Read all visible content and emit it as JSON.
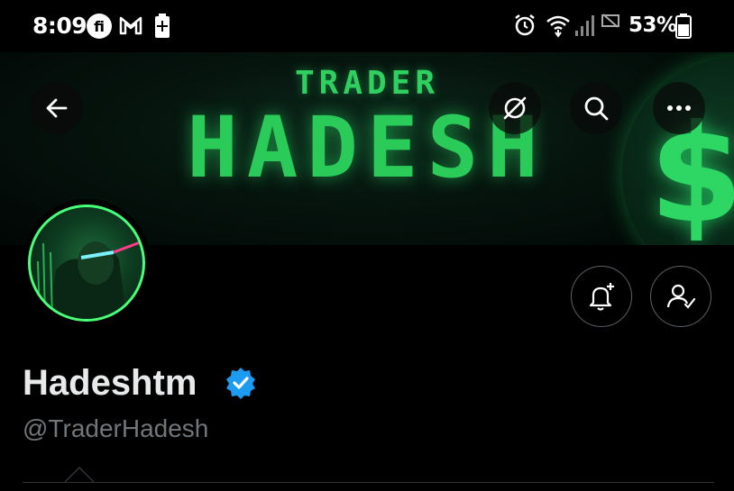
{
  "status_bar": {
    "time": "8:09",
    "battery_percent": "53%",
    "left_icons": [
      "fi-app-icon",
      "gmail-icon",
      "battery-saver-icon"
    ],
    "right_icons": [
      "alarm-icon",
      "wifi-icon",
      "signal-icon",
      "no-sim-icon",
      "battery-icon"
    ]
  },
  "banner": {
    "line1": "TRADER",
    "line2": "HADESH",
    "accent_color": "#2acb58"
  },
  "header_actions": {
    "back": "back-arrow-icon",
    "grok": "grok-icon",
    "search": "search-icon",
    "more": "more-icon"
  },
  "profile": {
    "display_name": "Hadeshtm",
    "handle": "@TraderHadesh",
    "verified": true,
    "verified_color": "#1d9bf0"
  },
  "actions": {
    "notify": "bell-plus-icon",
    "following": "person-check-icon"
  }
}
